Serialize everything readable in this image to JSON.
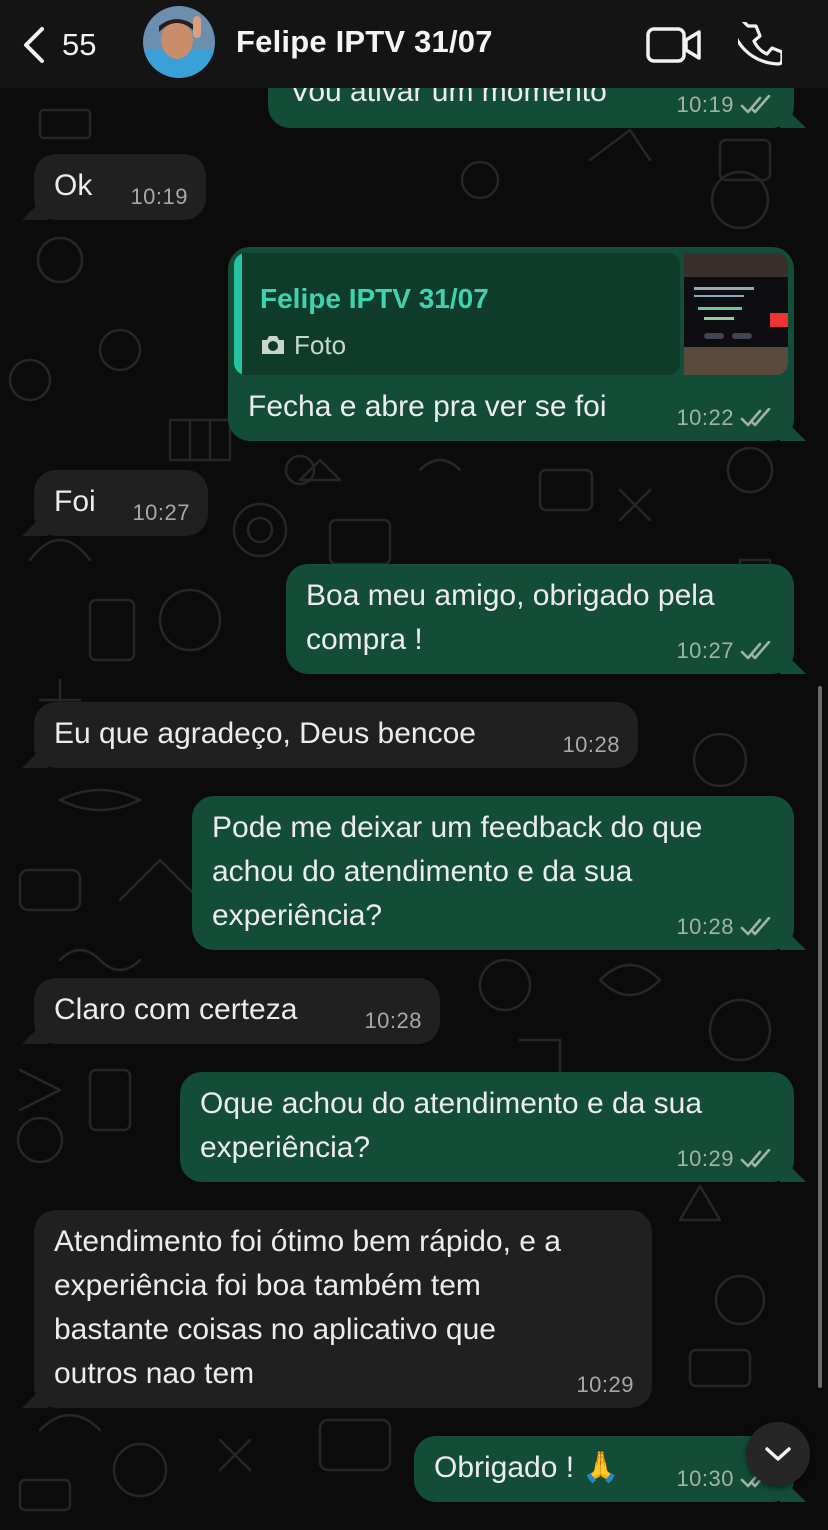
{
  "header": {
    "back_count": "55",
    "contact_name": "Felipe IPTV 31/07"
  },
  "colors": {
    "outgoing_bubble": "#144d37",
    "incoming_bubble": "#202020",
    "accent": "#3fd3ad",
    "read_ticks": "#9fb3a9"
  },
  "messages": [
    {
      "direction": "out",
      "text": "Vou ativar um momento",
      "time": "10:19",
      "status": "read"
    },
    {
      "direction": "in",
      "text": "Ok",
      "time": "10:19"
    },
    {
      "direction": "out",
      "reply_to": {
        "name": "Felipe IPTV 31/07",
        "kind": "Foto"
      },
      "text": "Fecha e abre pra ver se foi",
      "time": "10:22",
      "status": "read"
    },
    {
      "direction": "in",
      "text": "Foi",
      "time": "10:27"
    },
    {
      "direction": "out",
      "text": "Boa meu amigo, obrigado pela\ncompra !",
      "time": "10:27",
      "status": "read"
    },
    {
      "direction": "in",
      "text": "Eu que agradeço, Deus bencoe",
      "time": "10:28"
    },
    {
      "direction": "out",
      "text": "Pode me deixar um feedback do que\nachou do atendimento e da sua\nexperiência?",
      "time": "10:28",
      "status": "read"
    },
    {
      "direction": "in",
      "text": "Claro com certeza",
      "time": "10:28"
    },
    {
      "direction": "out",
      "text": "Oque achou do atendimento e da sua\nexperiência?",
      "time": "10:29",
      "status": "read"
    },
    {
      "direction": "in",
      "text": "Atendimento foi ótimo bem rápido, e a\nexperiência foi boa também tem\nbastante coisas no aplicativo que\noutros nao tem",
      "time": "10:29"
    },
    {
      "direction": "out",
      "text": "Obrigado ! 🙏",
      "time": "10:30",
      "status": "read"
    }
  ]
}
